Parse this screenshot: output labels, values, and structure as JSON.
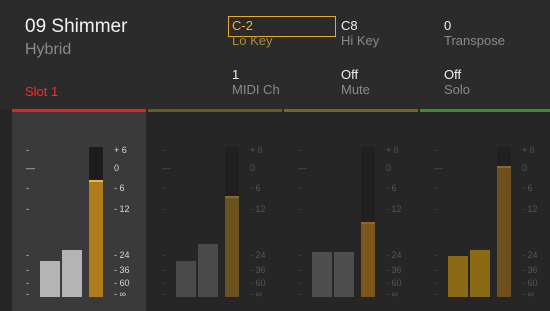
{
  "preset": {
    "name": "09 Shimmer",
    "type": "Hybrid",
    "slot": "Slot 1"
  },
  "params": {
    "lo_key": {
      "value": "C-2",
      "label": "Lo Key"
    },
    "hi_key": {
      "value": "C8",
      "label": "Hi Key"
    },
    "transpose": {
      "value": "0",
      "label": "Transpose"
    },
    "midi_ch": {
      "value": "1",
      "label": "MIDI Ch"
    },
    "mute": {
      "value": "Off",
      "label": "Mute"
    },
    "solo": {
      "value": "Off",
      "label": "Solo"
    }
  },
  "scale": {
    "left_marks": [
      "-",
      "—",
      "-",
      "-",
      "-",
      "-",
      "-",
      "-"
    ],
    "db_labels": [
      "+ 6",
      "0",
      "- 6",
      "- 12",
      "- 24",
      "- 36",
      "- 60",
      "- ∞"
    ]
  },
  "strips": [
    {
      "name": "slot-1",
      "accent": "#e8231f",
      "bar_color": "#b4b4b4",
      "meter_color": "#b07d1e",
      "active": true,
      "bars": [
        0.24,
        0.31
      ],
      "meter_level": 0.78
    },
    {
      "name": "slot-2",
      "accent": "#6a5a2a",
      "bar_color": "#4a4a4a",
      "meter_color": "#6c5120",
      "active": false,
      "bars": [
        0.24,
        0.35
      ],
      "meter_level": 0.67
    },
    {
      "name": "slot-3",
      "accent": "#7a6424",
      "bar_color": "#4e4e4e",
      "meter_color": "#7a561b",
      "active": false,
      "bars": [
        0.3,
        0.3
      ],
      "meter_level": 0.5
    },
    {
      "name": "slot-4",
      "accent": "#3f8a2a",
      "bar_color": "#8a6a16",
      "meter_color": "#6e4e1a",
      "active": false,
      "bars": [
        0.27,
        0.31
      ],
      "meter_level": 0.87
    }
  ],
  "colors": {
    "accent_selected": "#e7aa2e",
    "slot_red": "#ff2a2a"
  }
}
